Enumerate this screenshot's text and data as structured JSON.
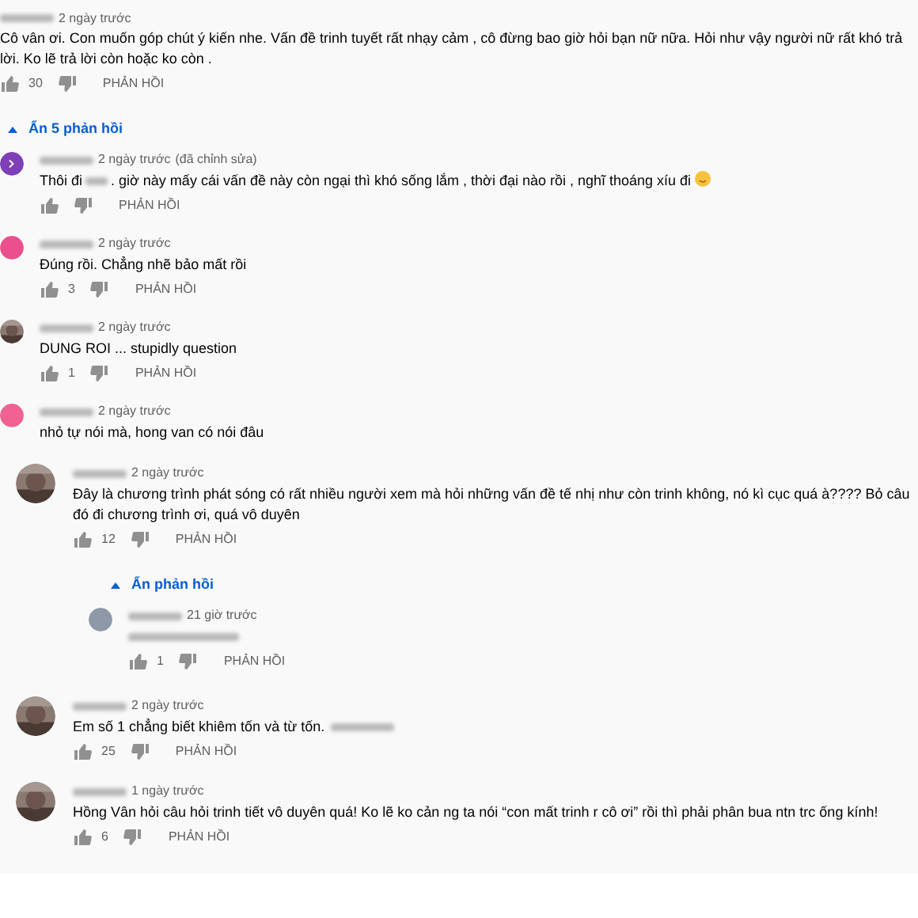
{
  "threads": [
    {
      "comment": {
        "time": "2 ngày trước",
        "text_parts": [
          "Cô vân ơi. Con muốn góp chút ý kiến nhe. Vấn đề trinh tuyết rất nhạy cảm , cô đừng bao giờ hỏi bạn nữ nữa. Hỏi như vậy người nữ rất khó trả lời. Ko lẽ trả lời còn hoặc ko còn ."
        ],
        "likes": "30",
        "reply": "PHẢN HỒI"
      },
      "toggle": "Ẩn 5 phản hồi",
      "replies": [
        {
          "avatar": {
            "kind": "letter",
            "color": "#7e3fb8"
          },
          "time": "2 ngày trước",
          "edited": "(đã chỉnh sửa)",
          "text_parts": [
            "Thôi đi",
            ". giờ này mấy cái vấn đề này còn ngại thì khó sống lắm , thời đại nào rồi , nghĩ thoáng xíu đi"
          ],
          "emoji": true,
          "reply": "PHẢN HỒI"
        },
        {
          "avatar": {
            "kind": "plain",
            "color": "#ec4f8e"
          },
          "time": "2 ngày trước",
          "text_parts": [
            "Đúng rồi. Chẳng nhẽ bảo mất rồi"
          ],
          "likes": "3",
          "reply": "PHẢN HỒI"
        },
        {
          "avatar": {
            "kind": "picture"
          },
          "time": "2 ngày trước",
          "text_parts": [
            "DUNG ROI ... stupidly question"
          ],
          "likes": "1",
          "reply": "PHẢN HỒI"
        },
        {
          "avatar": {
            "kind": "plain",
            "color": "#f06292"
          },
          "time": "2 ngày trước",
          "text_parts": [
            "nhỏ tự nói mà, hong van có nói đâu"
          ]
        }
      ]
    },
    {
      "comment": {
        "avatar": {
          "kind": "picture"
        },
        "time": "2 ngày trước",
        "text_parts": [
          "Đây là chương trình phát sóng có rất nhiều người xem mà hỏi những vấn đề tế nhị như còn trinh không, nó kì cục quá à???? Bỏ câu đó đi chương trình ơi, quá vô duyên"
        ],
        "likes": "12",
        "reply": "PHẢN HỒI"
      },
      "toggle": "Ẩn phản hồi",
      "replies": [
        {
          "avatar": {
            "kind": "plain",
            "color": "#8e99a8"
          },
          "time": "21 giờ trước",
          "redacted": true,
          "likes": "1",
          "reply": "PHẢN HỒI"
        }
      ]
    },
    {
      "comment": {
        "avatar": {
          "kind": "picture"
        },
        "time": "2 ngày trước",
        "text_parts": [
          "Em số 1 chẳng biết khiêm tốn và từ tốn."
        ],
        "redacted_tail": true,
        "likes": "25",
        "reply": "PHẢN HỒI"
      }
    },
    {
      "comment": {
        "avatar": {
          "kind": "picture"
        },
        "time": "1 ngày trước",
        "text_parts": [
          "Hồng Vân hỏi câu hỏi trinh tiết vô duyên quá! Ko lẽ ko cản ng ta nói “con mất trinh r cô ơi” rồi thì phải phân bua ntn trc ống kính!"
        ],
        "likes": "6",
        "reply": "PHẢN HỒI"
      }
    }
  ]
}
